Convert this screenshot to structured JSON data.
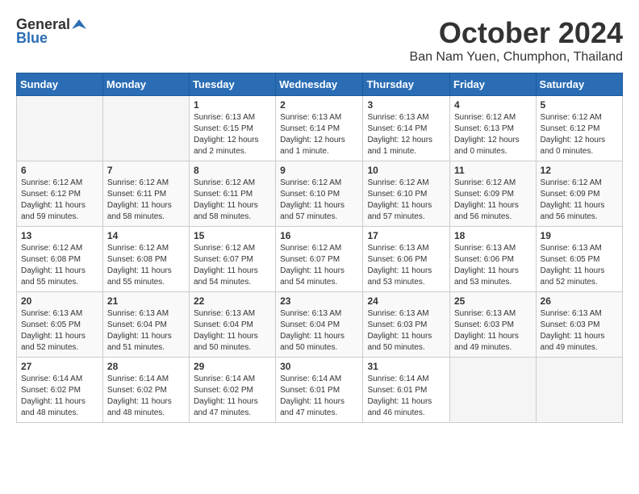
{
  "header": {
    "logo_general": "General",
    "logo_blue": "Blue",
    "month": "October 2024",
    "location": "Ban Nam Yuen, Chumphon, Thailand"
  },
  "weekdays": [
    "Sunday",
    "Monday",
    "Tuesday",
    "Wednesday",
    "Thursday",
    "Friday",
    "Saturday"
  ],
  "weeks": [
    [
      {
        "day": "",
        "sunrise": "",
        "sunset": "",
        "daylight": ""
      },
      {
        "day": "",
        "sunrise": "",
        "sunset": "",
        "daylight": ""
      },
      {
        "day": "1",
        "sunrise": "Sunrise: 6:13 AM",
        "sunset": "Sunset: 6:15 PM",
        "daylight": "Daylight: 12 hours and 2 minutes."
      },
      {
        "day": "2",
        "sunrise": "Sunrise: 6:13 AM",
        "sunset": "Sunset: 6:14 PM",
        "daylight": "Daylight: 12 hours and 1 minute."
      },
      {
        "day": "3",
        "sunrise": "Sunrise: 6:13 AM",
        "sunset": "Sunset: 6:14 PM",
        "daylight": "Daylight: 12 hours and 1 minute."
      },
      {
        "day": "4",
        "sunrise": "Sunrise: 6:12 AM",
        "sunset": "Sunset: 6:13 PM",
        "daylight": "Daylight: 12 hours and 0 minutes."
      },
      {
        "day": "5",
        "sunrise": "Sunrise: 6:12 AM",
        "sunset": "Sunset: 6:12 PM",
        "daylight": "Daylight: 12 hours and 0 minutes."
      }
    ],
    [
      {
        "day": "6",
        "sunrise": "Sunrise: 6:12 AM",
        "sunset": "Sunset: 6:12 PM",
        "daylight": "Daylight: 11 hours and 59 minutes."
      },
      {
        "day": "7",
        "sunrise": "Sunrise: 6:12 AM",
        "sunset": "Sunset: 6:11 PM",
        "daylight": "Daylight: 11 hours and 58 minutes."
      },
      {
        "day": "8",
        "sunrise": "Sunrise: 6:12 AM",
        "sunset": "Sunset: 6:11 PM",
        "daylight": "Daylight: 11 hours and 58 minutes."
      },
      {
        "day": "9",
        "sunrise": "Sunrise: 6:12 AM",
        "sunset": "Sunset: 6:10 PM",
        "daylight": "Daylight: 11 hours and 57 minutes."
      },
      {
        "day": "10",
        "sunrise": "Sunrise: 6:12 AM",
        "sunset": "Sunset: 6:10 PM",
        "daylight": "Daylight: 11 hours and 57 minutes."
      },
      {
        "day": "11",
        "sunrise": "Sunrise: 6:12 AM",
        "sunset": "Sunset: 6:09 PM",
        "daylight": "Daylight: 11 hours and 56 minutes."
      },
      {
        "day": "12",
        "sunrise": "Sunrise: 6:12 AM",
        "sunset": "Sunset: 6:09 PM",
        "daylight": "Daylight: 11 hours and 56 minutes."
      }
    ],
    [
      {
        "day": "13",
        "sunrise": "Sunrise: 6:12 AM",
        "sunset": "Sunset: 6:08 PM",
        "daylight": "Daylight: 11 hours and 55 minutes."
      },
      {
        "day": "14",
        "sunrise": "Sunrise: 6:12 AM",
        "sunset": "Sunset: 6:08 PM",
        "daylight": "Daylight: 11 hours and 55 minutes."
      },
      {
        "day": "15",
        "sunrise": "Sunrise: 6:12 AM",
        "sunset": "Sunset: 6:07 PM",
        "daylight": "Daylight: 11 hours and 54 minutes."
      },
      {
        "day": "16",
        "sunrise": "Sunrise: 6:12 AM",
        "sunset": "Sunset: 6:07 PM",
        "daylight": "Daylight: 11 hours and 54 minutes."
      },
      {
        "day": "17",
        "sunrise": "Sunrise: 6:13 AM",
        "sunset": "Sunset: 6:06 PM",
        "daylight": "Daylight: 11 hours and 53 minutes."
      },
      {
        "day": "18",
        "sunrise": "Sunrise: 6:13 AM",
        "sunset": "Sunset: 6:06 PM",
        "daylight": "Daylight: 11 hours and 53 minutes."
      },
      {
        "day": "19",
        "sunrise": "Sunrise: 6:13 AM",
        "sunset": "Sunset: 6:05 PM",
        "daylight": "Daylight: 11 hours and 52 minutes."
      }
    ],
    [
      {
        "day": "20",
        "sunrise": "Sunrise: 6:13 AM",
        "sunset": "Sunset: 6:05 PM",
        "daylight": "Daylight: 11 hours and 52 minutes."
      },
      {
        "day": "21",
        "sunrise": "Sunrise: 6:13 AM",
        "sunset": "Sunset: 6:04 PM",
        "daylight": "Daylight: 11 hours and 51 minutes."
      },
      {
        "day": "22",
        "sunrise": "Sunrise: 6:13 AM",
        "sunset": "Sunset: 6:04 PM",
        "daylight": "Daylight: 11 hours and 50 minutes."
      },
      {
        "day": "23",
        "sunrise": "Sunrise: 6:13 AM",
        "sunset": "Sunset: 6:04 PM",
        "daylight": "Daylight: 11 hours and 50 minutes."
      },
      {
        "day": "24",
        "sunrise": "Sunrise: 6:13 AM",
        "sunset": "Sunset: 6:03 PM",
        "daylight": "Daylight: 11 hours and 50 minutes."
      },
      {
        "day": "25",
        "sunrise": "Sunrise: 6:13 AM",
        "sunset": "Sunset: 6:03 PM",
        "daylight": "Daylight: 11 hours and 49 minutes."
      },
      {
        "day": "26",
        "sunrise": "Sunrise: 6:13 AM",
        "sunset": "Sunset: 6:03 PM",
        "daylight": "Daylight: 11 hours and 49 minutes."
      }
    ],
    [
      {
        "day": "27",
        "sunrise": "Sunrise: 6:14 AM",
        "sunset": "Sunset: 6:02 PM",
        "daylight": "Daylight: 11 hours and 48 minutes."
      },
      {
        "day": "28",
        "sunrise": "Sunrise: 6:14 AM",
        "sunset": "Sunset: 6:02 PM",
        "daylight": "Daylight: 11 hours and 48 minutes."
      },
      {
        "day": "29",
        "sunrise": "Sunrise: 6:14 AM",
        "sunset": "Sunset: 6:02 PM",
        "daylight": "Daylight: 11 hours and 47 minutes."
      },
      {
        "day": "30",
        "sunrise": "Sunrise: 6:14 AM",
        "sunset": "Sunset: 6:01 PM",
        "daylight": "Daylight: 11 hours and 47 minutes."
      },
      {
        "day": "31",
        "sunrise": "Sunrise: 6:14 AM",
        "sunset": "Sunset: 6:01 PM",
        "daylight": "Daylight: 11 hours and 46 minutes."
      },
      {
        "day": "",
        "sunrise": "",
        "sunset": "",
        "daylight": ""
      },
      {
        "day": "",
        "sunrise": "",
        "sunset": "",
        "daylight": ""
      }
    ]
  ]
}
